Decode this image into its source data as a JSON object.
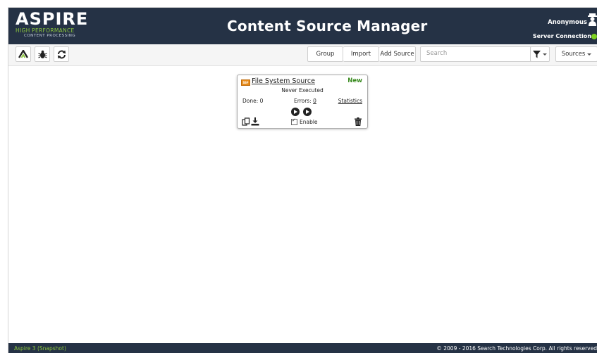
{
  "header": {
    "logo_main": "ASPIRE",
    "logo_sub1": "HIGH PERFORMANCE",
    "logo_sub2": "CONTENT PROCESSING",
    "title": "Content Source Manager",
    "user": "Anonymous",
    "server_status": "Server Connection",
    "server_status_color": "#7ed321"
  },
  "toolbar": {
    "icons": [
      "aspire-logo-icon",
      "bug-icon",
      "refresh-icon"
    ],
    "group_label": "Group",
    "import_label": "Import",
    "add_source_label": "Add Source",
    "search_placeholder": "Search",
    "filter_icon": "filter-icon",
    "sources_label": "Sources"
  },
  "sources": [
    {
      "icon": "file-system-icon",
      "icon_label": "SSF",
      "name": "File System Source",
      "status": "New",
      "status_color": "#3a8b20",
      "execution": "Never Executed",
      "done_label": "Done: 0",
      "errors_label": "Errors:",
      "errors_count": "0",
      "statistics_label": "Statistics",
      "enable_label": "Enable",
      "enabled": true
    }
  ],
  "footer": {
    "version": "Aspire 3 (Snapshot)",
    "copyright": "© 2009 - 2016 Search Technologies Corp. All rights reserved"
  },
  "colors": {
    "header_bg": "#253245",
    "accent_green": "#8cc63f",
    "toolbar_bg": "#f5f5f5"
  }
}
